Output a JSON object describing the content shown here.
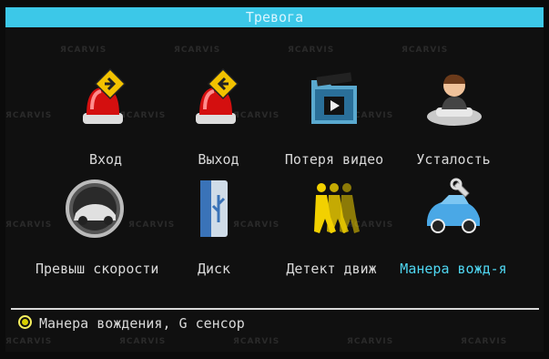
{
  "title": "Тревога",
  "watermark": "ЯCARVIS",
  "tiles": [
    {
      "label": "Вход",
      "icon": "alarm-in-icon"
    },
    {
      "label": "Выход",
      "icon": "alarm-out-icon"
    },
    {
      "label": "Потеря видео",
      "icon": "video-loss-icon"
    },
    {
      "label": "Усталость",
      "icon": "fatigue-driver-icon"
    },
    {
      "label": "Превыш скорости",
      "icon": "speedometer-car-icon"
    },
    {
      "label": "Диск",
      "icon": "usb-disk-icon"
    },
    {
      "label": "Детект движ",
      "icon": "motion-detect-icon"
    },
    {
      "label": "Манера вожд-я",
      "icon": "driving-behavior-icon"
    }
  ],
  "selected_index": 7,
  "status": {
    "text": "Манера вождения, G сенсор",
    "icon": "radio-selected-icon"
  },
  "colors": {
    "title_bar": "#3cc8e8",
    "selected_text": "#4fd7f2",
    "text": "#d9d9d9",
    "background": "#101010"
  }
}
